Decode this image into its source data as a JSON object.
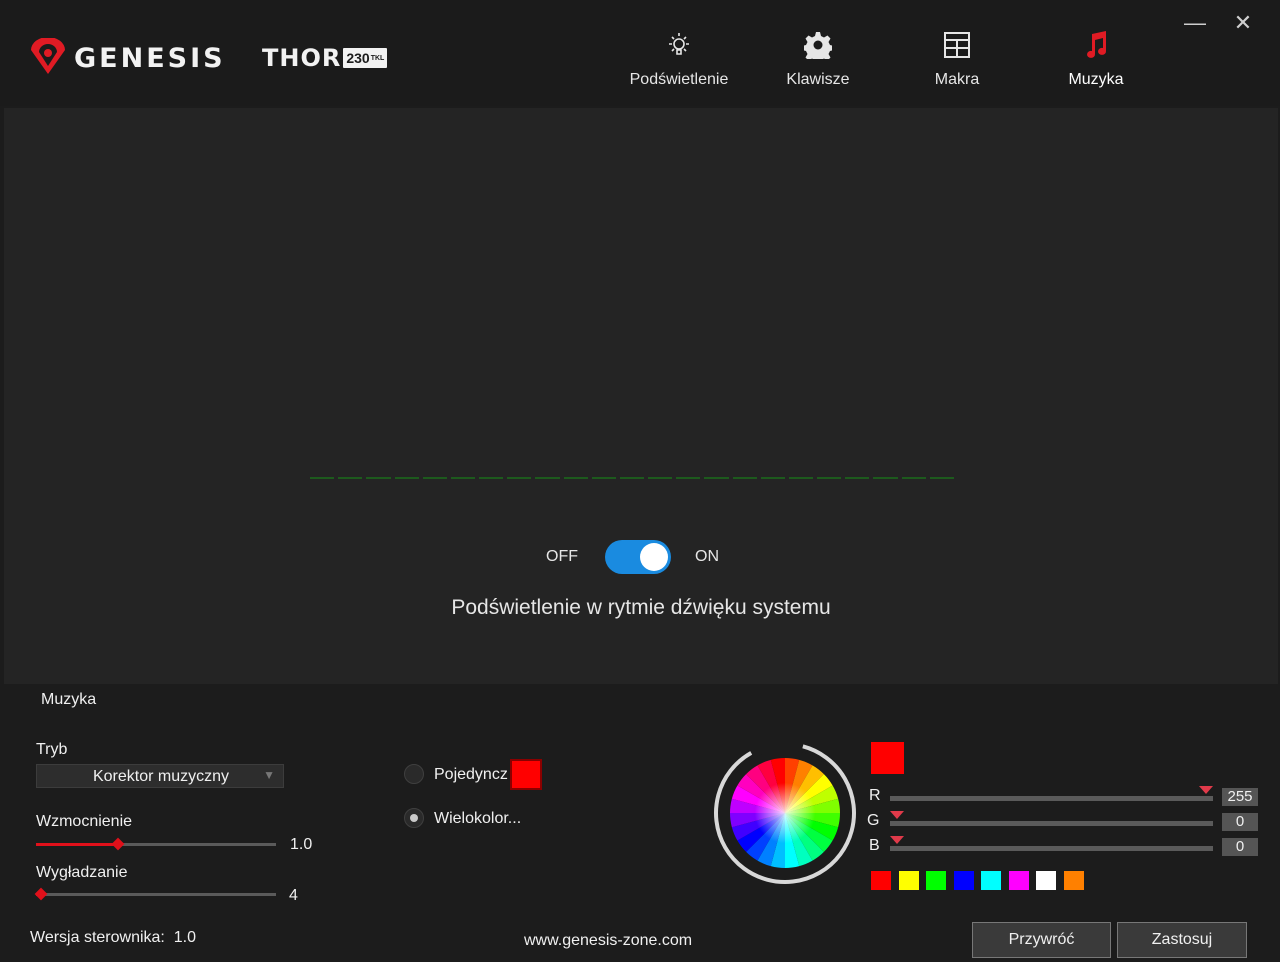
{
  "header": {
    "brand": "GENESIS",
    "model": "THOR",
    "model_badge": "230",
    "model_badge_suffix": "TKL",
    "nav": [
      {
        "label": "Podświetlenie",
        "icon": "light-bulb-icon"
      },
      {
        "label": "Klawisze",
        "icon": "gear-icon"
      },
      {
        "label": "Makra",
        "icon": "grid-icon"
      },
      {
        "label": "Muzyka",
        "icon": "music-note-icon",
        "active": true
      }
    ],
    "minimize": "—",
    "close": "✕"
  },
  "preview": {
    "toggle_off": "OFF",
    "toggle_on": "ON",
    "toggle_state": true,
    "subtitle": "Podświetlenie w rytmie dźwięku systemu"
  },
  "music": {
    "section_title": "Muzyka",
    "mode_label": "Tryb",
    "mode_value": "Korektor muzyczny",
    "gain_label": "Wzmocnienie",
    "gain_value": "1.0",
    "gain_fraction": 0.34,
    "smooth_label": "Wygładzanie",
    "smooth_value": "4",
    "smooth_fraction": 0.02,
    "radio_single": "Pojedyncz",
    "radio_multi": "Wielokolor...",
    "selected_mode": "multi"
  },
  "color": {
    "r_label": "R",
    "g_label": "G",
    "b_label": "B",
    "r_value": "255",
    "g_value": "0",
    "b_value": "0",
    "current": "#ff0000",
    "presets": [
      "#ff0000",
      "#ffff00",
      "#00ff00",
      "#0000ff",
      "#00ffff",
      "#ff00ff",
      "#ffffff",
      "#ff8000"
    ]
  },
  "footer": {
    "version_label": "Wersja sterownika:",
    "version_value": "1.0",
    "website": "www.genesis-zone.com",
    "restore_button": "Przywróć",
    "apply_button": "Zastosuj"
  }
}
